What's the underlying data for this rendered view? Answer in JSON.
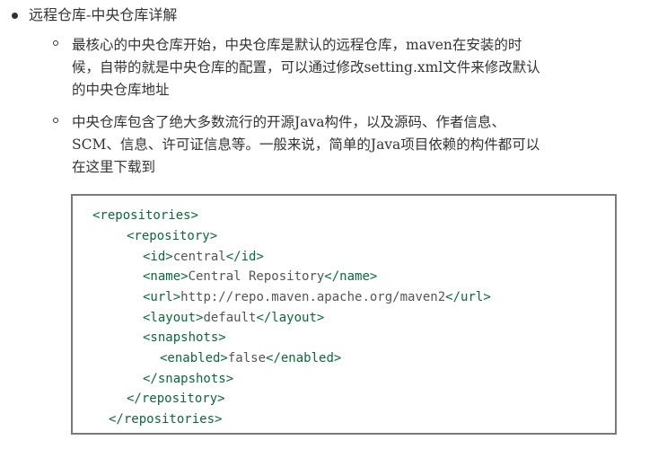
{
  "section": {
    "heading": "远程仓库-中央仓库详解"
  },
  "items": [
    {
      "lines": [
        "最核心的中央仓库开始，中央仓库是默认的远程仓库，maven在安装的时",
        "候，自带的就是中央仓库的配置，可以通过修改setting.xml文件来修改默认",
        "的中央仓库地址"
      ]
    },
    {
      "lines": [
        "中央仓库包含了绝大多数流行的开源Java构件，以及源码、作者信息、",
        "SCM、信息、许可证信息等。一般来说，简单的Java项目依赖的构件都可以",
        "在这里下载到"
      ]
    }
  ],
  "code": {
    "lines": [
      {
        "open": "<repositories>",
        "text": "",
        "close": ""
      },
      {
        "open": "<repository>",
        "text": "",
        "close": ""
      },
      {
        "open": "<id>",
        "text": "central",
        "close": "</id>"
      },
      {
        "open": "<name>",
        "text": "Central Repository",
        "close": "</name>"
      },
      {
        "open": "<url>",
        "text": "http://repo.maven.apache.org/maven2",
        "close": "</url>"
      },
      {
        "open": "<layout>",
        "text": "default",
        "close": "</layout>"
      },
      {
        "open": "<snapshots>",
        "text": "",
        "close": ""
      },
      {
        "open": "<enabled>",
        "text": "false",
        "close": "</enabled>"
      },
      {
        "open": "</snapshots>",
        "text": "",
        "close": ""
      },
      {
        "open": "</repository>",
        "text": "",
        "close": ""
      },
      {
        "open": "</repositories>",
        "text": "",
        "close": ""
      }
    ]
  },
  "colors": {
    "tag": "#0a6b3a",
    "text": "#555555",
    "body_text": "#333333",
    "code_border": "#7a7a7a"
  }
}
